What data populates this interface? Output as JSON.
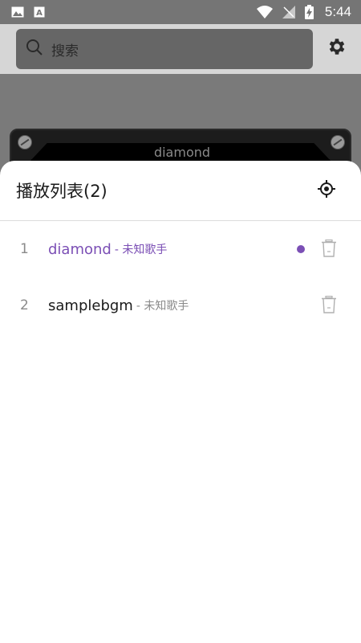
{
  "status_bar": {
    "time": "5:44",
    "left_icons": [
      "image-icon",
      "text-icon"
    ],
    "right_icons": [
      "wifi-icon",
      "signal-icon",
      "battery-charging-icon"
    ]
  },
  "search": {
    "placeholder": "搜索"
  },
  "player": {
    "current_song": "diamond"
  },
  "playlist": {
    "title": "播放列表(2)",
    "tracks": [
      {
        "index": "1",
        "title": "diamond",
        "artist": "- 未知歌手",
        "playing": true
      },
      {
        "index": "2",
        "title": "samplebgm",
        "artist": "- 未知歌手",
        "playing": false
      }
    ]
  },
  "colors": {
    "accent": "#7b4fb5",
    "scrim": "#7a7a7a",
    "text_primary": "#1a1a1a",
    "text_secondary": "#8a8a8a"
  }
}
